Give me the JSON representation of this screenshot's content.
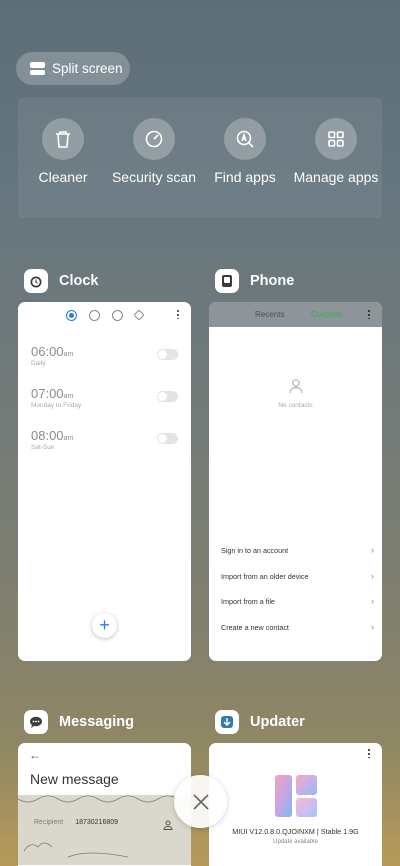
{
  "split_screen": {
    "label": "Split screen"
  },
  "tools": [
    {
      "label": "Cleaner",
      "icon": "trash-icon"
    },
    {
      "label": "Security scan",
      "icon": "gauge-icon"
    },
    {
      "label": "Find apps",
      "icon": "app-search-icon"
    },
    {
      "label": "Manage apps",
      "icon": "grid-icon"
    }
  ],
  "cards": {
    "clock": {
      "title": "Clock",
      "alarms": [
        {
          "time": "06:00",
          "ampm": "am",
          "repeat": "Daily"
        },
        {
          "time": "07:00",
          "ampm": "am",
          "repeat": "Monday to Friday"
        },
        {
          "time": "08:00",
          "ampm": "am",
          "repeat": "Sat-Sun"
        }
      ],
      "add": "+"
    },
    "phone": {
      "title": "Phone",
      "tab_recents": "Recents",
      "tab_contacts": "Contacts",
      "empty": "No contacts",
      "options": [
        "Sign in to an account",
        "Import from an older device",
        "Import from a file",
        "Create a new contact"
      ]
    },
    "messaging": {
      "title": "Messaging",
      "heading": "New message",
      "recipient_label": "Recipient",
      "recipient_value": "18730216809"
    },
    "updater": {
      "title": "Updater",
      "version": "MIUI V12.0.8.0.QJOINXM | Stable 1.9G",
      "status": "Update available"
    }
  },
  "close": {
    "icon": "close-icon"
  }
}
